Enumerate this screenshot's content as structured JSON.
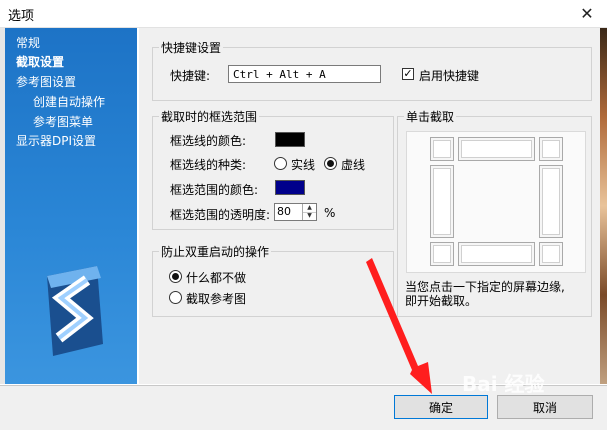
{
  "window": {
    "title": "选项"
  },
  "sidebar": {
    "items": [
      {
        "label": "常规",
        "selected": false
      },
      {
        "label": "截取设置",
        "selected": true
      },
      {
        "label": "参考图设置",
        "selected": false
      },
      {
        "label": "创建自动操作",
        "selected": false
      },
      {
        "label": "参考图菜单",
        "selected": false
      },
      {
        "label": "显示器DPI设置",
        "selected": false
      }
    ]
  },
  "hotkey_group": {
    "title": "快捷键设置",
    "label": "快捷键:",
    "value": "Ctrl + Alt + A",
    "enable_label": "启用快捷键",
    "enabled": true
  },
  "frame_group": {
    "title": "截取时的框选范围",
    "line_color_label": "框选线的颜色:",
    "line_color": "#000000",
    "line_type_label": "框选线的种类:",
    "solid_label": "实线",
    "dashed_label": "虚线",
    "selected_line_type": "dashed",
    "fill_color_label": "框选范围的颜色:",
    "fill_color": "#00008b",
    "opacity_label": "框选范围的透明度:",
    "opacity_value": "80",
    "opacity_unit": "%"
  },
  "single_click_group": {
    "title": "单击截取",
    "hint": "当您点击一下指定的屏幕边缘,\n即开始截取。"
  },
  "double_start_group": {
    "title": "防止双重启动的操作",
    "option1": "什么都不做",
    "option2": "截取参考图",
    "selected": "option1"
  },
  "buttons": {
    "ok": "确定",
    "cancel": "取消"
  },
  "watermark": "Bai 经验"
}
